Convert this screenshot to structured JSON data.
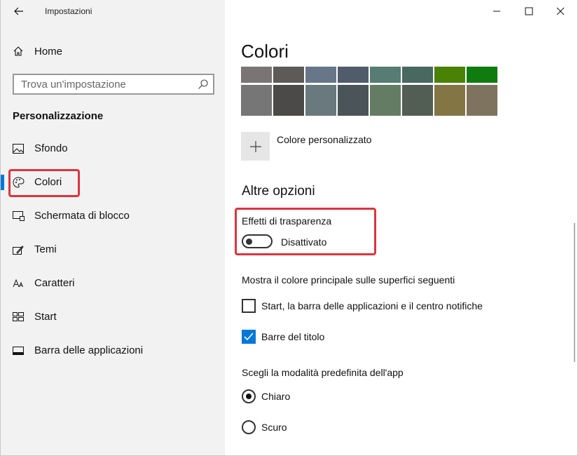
{
  "window": {
    "title": "Impostazioni",
    "controls": {
      "minimize": "minimize-icon",
      "maximize": "maximize-icon",
      "close": "close-icon"
    }
  },
  "sidebar": {
    "home_label": "Home",
    "search_placeholder": "Trova un'impostazione",
    "section_title": "Personalizzazione",
    "items": [
      {
        "label": "Sfondo",
        "icon": "picture-icon"
      },
      {
        "label": "Colori",
        "icon": "palette-icon",
        "active": true
      },
      {
        "label": "Schermata di blocco",
        "icon": "lock-screen-icon"
      },
      {
        "label": "Temi",
        "icon": "themes-icon"
      },
      {
        "label": "Caratteri",
        "icon": "fonts-icon"
      },
      {
        "label": "Start",
        "icon": "start-icon"
      },
      {
        "label": "Barra delle applicazioni",
        "icon": "taskbar-icon"
      }
    ],
    "accent_color": "#0078d7"
  },
  "main": {
    "title": "Colori",
    "swatches_row1": [
      "#7a7574",
      "#5d5a58",
      "#68768a",
      "#515c6b",
      "#567c73",
      "#486860",
      "#498205",
      "#107c10"
    ],
    "swatches_row2": [
      "#767676",
      "#4c4a48",
      "#69797e",
      "#4a5459",
      "#647c64",
      "#525e54",
      "#847545",
      "#7e735f"
    ],
    "custom_color_label": "Colore personalizzato",
    "other_options_title": "Altre opzioni",
    "transparency": {
      "label": "Effetti di trasparenza",
      "state_label": "Disattivato",
      "on": false
    },
    "accent_surfaces_label": "Mostra il colore principale sulle superfici seguenti",
    "checkbox_start": {
      "label": "Start, la barra delle applicazioni e il centro notifiche",
      "checked": false
    },
    "checkbox_titlebars": {
      "label": "Barre del titolo",
      "checked": true
    },
    "app_mode_label": "Scegli la modalità predefinita dell'app",
    "radio_light": {
      "label": "Chiaro",
      "selected": true
    },
    "radio_dark": {
      "label": "Scuro",
      "selected": false
    }
  },
  "highlight_color": "#d9363e"
}
